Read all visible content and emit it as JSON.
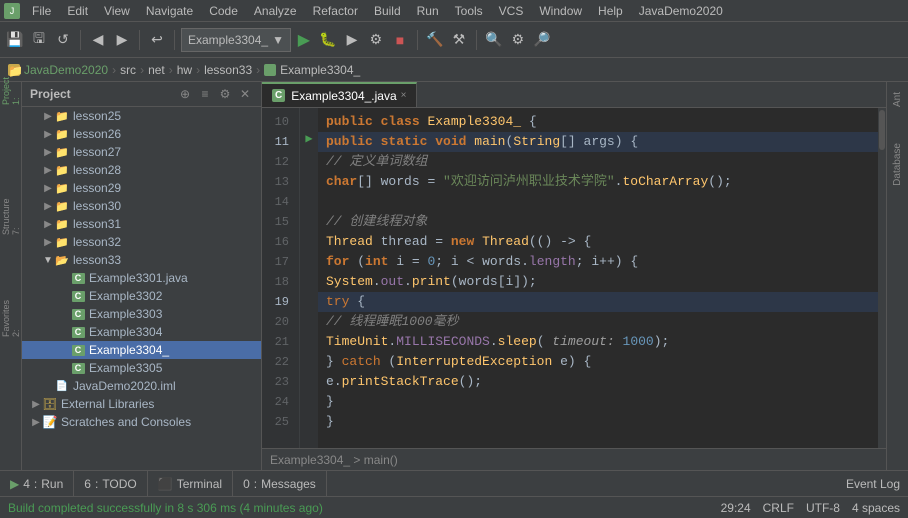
{
  "app": {
    "title": "JavaDemo2020",
    "window_title": "JavaDemo2020"
  },
  "menubar": {
    "items": [
      "File",
      "Edit",
      "View",
      "Navigate",
      "Code",
      "Analyze",
      "Refactor",
      "Build",
      "Run",
      "Tools",
      "VCS",
      "Window",
      "Help",
      "JavaDemo2020"
    ]
  },
  "toolbar": {
    "dropdown_label": "Example3304_",
    "buttons": [
      "save",
      "save-all",
      "sync",
      "back",
      "forward",
      "undo",
      "run",
      "debug",
      "run-coverage",
      "run-config",
      "stop",
      "build",
      "hammer",
      "search-everywhere",
      "settings",
      "search"
    ]
  },
  "breadcrumb": {
    "items": [
      "JavaDemo2020",
      "src",
      "net",
      "hw",
      "lesson33",
      "Example3304_"
    ]
  },
  "project_panel": {
    "title": "Project",
    "tree_items": [
      {
        "label": "lesson25",
        "indent": 1,
        "type": "folder",
        "expanded": false
      },
      {
        "label": "lesson26",
        "indent": 1,
        "type": "folder",
        "expanded": false
      },
      {
        "label": "lesson27",
        "indent": 1,
        "type": "folder",
        "expanded": false
      },
      {
        "label": "lesson28",
        "indent": 1,
        "type": "folder",
        "expanded": false
      },
      {
        "label": "lesson29",
        "indent": 1,
        "type": "folder",
        "expanded": false
      },
      {
        "label": "lesson30",
        "indent": 1,
        "type": "folder",
        "expanded": false
      },
      {
        "label": "lesson31",
        "indent": 1,
        "type": "folder",
        "expanded": false
      },
      {
        "label": "lesson32",
        "indent": 1,
        "type": "folder",
        "expanded": false
      },
      {
        "label": "lesson33",
        "indent": 1,
        "type": "folder",
        "expanded": true
      },
      {
        "label": "Example3301.java",
        "indent": 2,
        "type": "java"
      },
      {
        "label": "Example3302",
        "indent": 2,
        "type": "java"
      },
      {
        "label": "Example3303",
        "indent": 2,
        "type": "java"
      },
      {
        "label": "Example3304",
        "indent": 2,
        "type": "java"
      },
      {
        "label": "Example3304_",
        "indent": 2,
        "type": "java",
        "selected": true
      },
      {
        "label": "Example3305",
        "indent": 2,
        "type": "java"
      },
      {
        "label": "JavaDemo2020.iml",
        "indent": 1,
        "type": "iml"
      },
      {
        "label": "External Libraries",
        "indent": 0,
        "type": "ext"
      },
      {
        "label": "Scratches and Consoles",
        "indent": 0,
        "type": "scratches"
      }
    ]
  },
  "editor": {
    "tab_label": "Example3304_.java",
    "lines": [
      {
        "num": 10,
        "content": "public class Example3304_ {",
        "type": "code"
      },
      {
        "num": 11,
        "content": "    public static void main(String[] args) {",
        "type": "code",
        "has_arrow": true
      },
      {
        "num": 12,
        "content": "        // 定义单词数组",
        "type": "comment"
      },
      {
        "num": 13,
        "content": "        char[] words = \"欢迎访问泸州职业技术学院\".toCharArray();",
        "type": "code"
      },
      {
        "num": 14,
        "content": "",
        "type": "empty"
      },
      {
        "num": 15,
        "content": "        // 创建线程对象",
        "type": "comment"
      },
      {
        "num": 16,
        "content": "        Thread thread = new Thread(() -> {",
        "type": "code"
      },
      {
        "num": 17,
        "content": "            for (int i = 0; i < words.length; i++) {",
        "type": "code"
      },
      {
        "num": 18,
        "content": "                System.out.print(words[i]);",
        "type": "code"
      },
      {
        "num": 19,
        "content": "                try {",
        "type": "code"
      },
      {
        "num": 20,
        "content": "                    // 线程睡眠1000毫秒",
        "type": "comment"
      },
      {
        "num": 21,
        "content": "                    TimeUnit.MILLISECONDS.sleep( timeout: 1000);",
        "type": "code"
      },
      {
        "num": 22,
        "content": "                } catch (InterruptedException e) {",
        "type": "code"
      },
      {
        "num": 23,
        "content": "                    e.printStackTrace();",
        "type": "code"
      },
      {
        "num": 24,
        "content": "                }",
        "type": "code"
      },
      {
        "num": 25,
        "content": "            }",
        "type": "code"
      }
    ],
    "breadcrumb": "Example3304_  >  main()"
  },
  "right_tabs": [
    "Ant",
    "Database"
  ],
  "bottom_tabs": [
    {
      "num": "4",
      "label": "Run"
    },
    {
      "num": "6",
      "label": "TODO"
    },
    {
      "label": "Terminal"
    },
    {
      "num": "0",
      "label": "Messages"
    }
  ],
  "bottom_right": "Event Log",
  "status_bar": {
    "message": "Build completed successfully in 8 s 306 ms (4 minutes ago)",
    "position": "29:24",
    "line_ending": "CRLF",
    "encoding": "UTF-8",
    "indent": "4 spaces"
  }
}
